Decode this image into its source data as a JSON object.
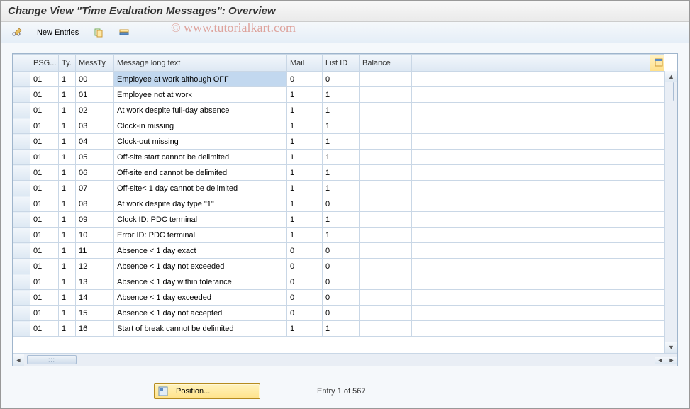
{
  "header": {
    "title": "Change View \"Time Evaluation Messages\": Overview"
  },
  "watermark": "© www.tutorialkart.com",
  "toolbar": {
    "new_entries_label": "New Entries"
  },
  "columns": {
    "psg": "PSG...",
    "ty": "Ty.",
    "messty": "MessTy",
    "msg": "Message long text",
    "mail": "Mail",
    "listid": "List ID",
    "balance": "Balance"
  },
  "rows": [
    {
      "psg": "01",
      "ty": "1",
      "messty": "00",
      "msg": "Employee at work although OFF",
      "mail": "0",
      "listid": "0",
      "balance": "",
      "selected": true
    },
    {
      "psg": "01",
      "ty": "1",
      "messty": "01",
      "msg": "Employee not at work",
      "mail": "1",
      "listid": "1",
      "balance": ""
    },
    {
      "psg": "01",
      "ty": "1",
      "messty": "02",
      "msg": "At work despite full-day absence",
      "mail": "1",
      "listid": "1",
      "balance": ""
    },
    {
      "psg": "01",
      "ty": "1",
      "messty": "03",
      "msg": "Clock-in missing",
      "mail": "1",
      "listid": "1",
      "balance": ""
    },
    {
      "psg": "01",
      "ty": "1",
      "messty": "04",
      "msg": "Clock-out missing",
      "mail": "1",
      "listid": "1",
      "balance": ""
    },
    {
      "psg": "01",
      "ty": "1",
      "messty": "05",
      "msg": "Off-site start cannot be delimited",
      "mail": "1",
      "listid": "1",
      "balance": ""
    },
    {
      "psg": "01",
      "ty": "1",
      "messty": "06",
      "msg": "Off-site end cannot be delimited",
      "mail": "1",
      "listid": "1",
      "balance": ""
    },
    {
      "psg": "01",
      "ty": "1",
      "messty": "07",
      "msg": "Off-site< 1 day cannot be delimited",
      "mail": "1",
      "listid": "1",
      "balance": ""
    },
    {
      "psg": "01",
      "ty": "1",
      "messty": "08",
      "msg": "At work despite day type \"1\"",
      "mail": "1",
      "listid": "0",
      "balance": ""
    },
    {
      "psg": "01",
      "ty": "1",
      "messty": "09",
      "msg": "Clock ID: PDC terminal",
      "mail": "1",
      "listid": "1",
      "balance": ""
    },
    {
      "psg": "01",
      "ty": "1",
      "messty": "10",
      "msg": "Error ID: PDC terminal",
      "mail": "1",
      "listid": "1",
      "balance": ""
    },
    {
      "psg": "01",
      "ty": "1",
      "messty": "11",
      "msg": "Absence < 1 day exact",
      "mail": "0",
      "listid": "0",
      "balance": ""
    },
    {
      "psg": "01",
      "ty": "1",
      "messty": "12",
      "msg": "Absence < 1 day not exceeded",
      "mail": "0",
      "listid": "0",
      "balance": ""
    },
    {
      "psg": "01",
      "ty": "1",
      "messty": "13",
      "msg": "Absence < 1 day within tolerance",
      "mail": "0",
      "listid": "0",
      "balance": ""
    },
    {
      "psg": "01",
      "ty": "1",
      "messty": "14",
      "msg": "Absence < 1 day exceeded",
      "mail": "0",
      "listid": "0",
      "balance": ""
    },
    {
      "psg": "01",
      "ty": "1",
      "messty": "15",
      "msg": "Absence < 1 day not accepted",
      "mail": "0",
      "listid": "0",
      "balance": ""
    },
    {
      "psg": "01",
      "ty": "1",
      "messty": "16",
      "msg": "Start of break cannot be delimited",
      "mail": "1",
      "listid": "1",
      "balance": ""
    }
  ],
  "footer": {
    "position_label": "Position...",
    "entry_label": "Entry 1 of 567"
  }
}
